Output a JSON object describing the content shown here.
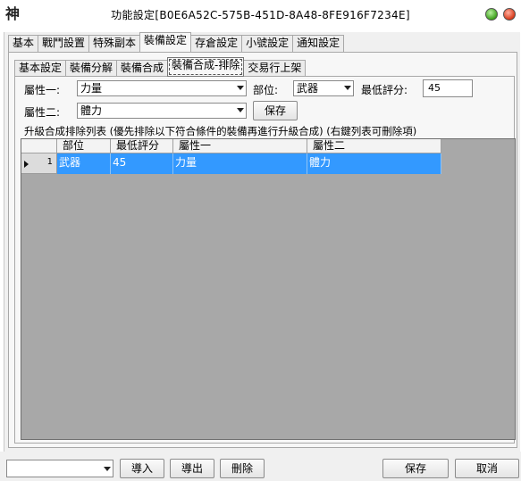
{
  "window": {
    "icon_glyph": "神",
    "title": "功能設定[B0E6A52C-575B-451D-8A48-8FE916F7234E]"
  },
  "outer_tabs": [
    "基本",
    "戰鬥設置",
    "特殊副本",
    "裝備設定",
    "存倉設定",
    "小號設定",
    "通知設定"
  ],
  "inner_tabs": [
    "基本設定",
    "裝備分解",
    "裝備合成",
    "裝備合成-排除",
    "交易行上架"
  ],
  "form": {
    "attr1_label": "屬性一:",
    "attr1_value": "力量",
    "part_label": "部位:",
    "part_value": "武器",
    "min_score_label": "最低評分:",
    "min_score_value": "45",
    "attr2_label": "屬性二:",
    "attr2_value": "體力",
    "save_label": "保存"
  },
  "list": {
    "caption": "升級合成排除列表 (優先排除以下符合條件的裝備再進行升級合成) (右鍵列表可刪除項)",
    "columns": [
      "部位",
      "最低評分",
      "屬性一",
      "屬性二"
    ],
    "rows": [
      {
        "index": "1",
        "part": "武器",
        "min_score": "45",
        "attr1": "力量",
        "attr2": "體力"
      }
    ]
  },
  "bottom": {
    "import_label": "導入",
    "export_label": "導出",
    "delete_label": "刪除",
    "save_label": "保存",
    "cancel_label": "取消"
  }
}
